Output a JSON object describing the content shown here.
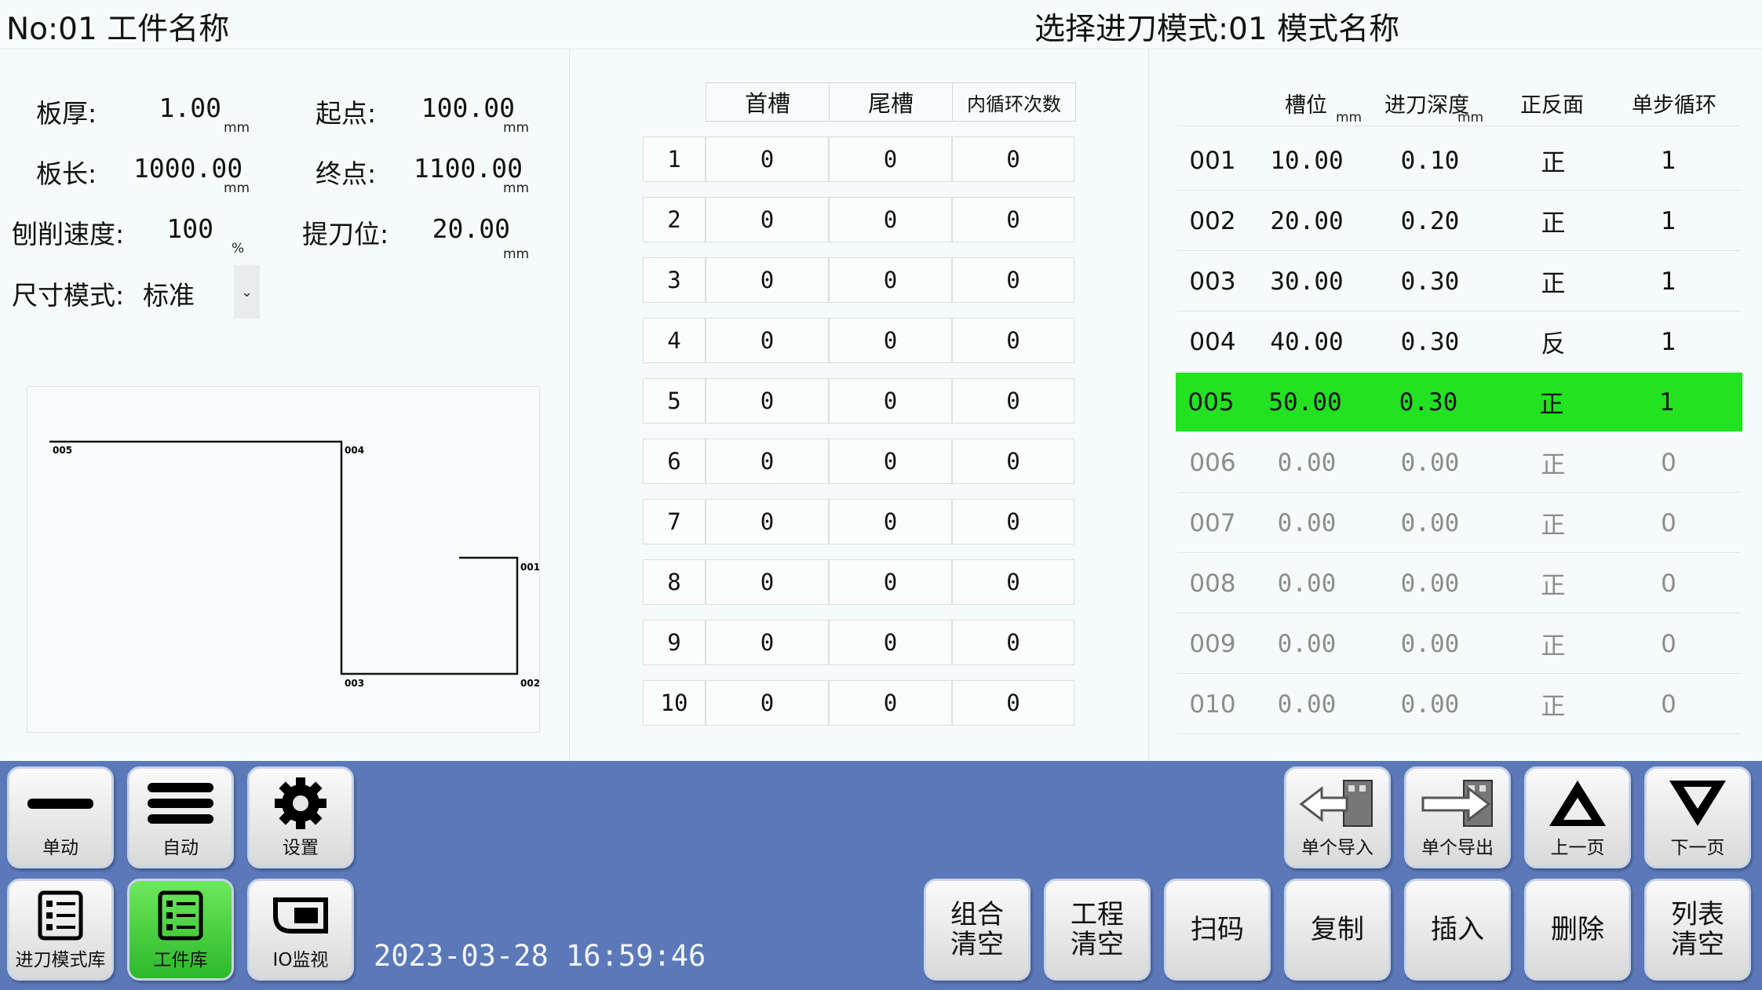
{
  "header": {
    "workpiece": "No:01 工件名称",
    "feed_mode": "选择进刀模式:01 模式名称"
  },
  "params": {
    "thickness": {
      "label": "板厚:",
      "value": "1.00",
      "unit": "mm"
    },
    "start": {
      "label": "起点:",
      "value": "100.00",
      "unit": "mm"
    },
    "length": {
      "label": "板长:",
      "value": "1000.00",
      "unit": "mm"
    },
    "end": {
      "label": "终点:",
      "value": "1100.00",
      "unit": "mm"
    },
    "speed": {
      "label": "刨削速度:",
      "value": "100",
      "unit": "%"
    },
    "lift": {
      "label": "提刀位:",
      "value": "20.00",
      "unit": "mm"
    },
    "size_mode": {
      "label": "尺寸模式:",
      "value": "标准"
    }
  },
  "preview": {
    "labels": [
      "005",
      "004",
      "001",
      "003",
      "002"
    ]
  },
  "groove_table": {
    "headers": [
      "首槽",
      "尾槽",
      "内循环次数"
    ],
    "rows": [
      [
        "1",
        "0",
        "0",
        "0"
      ],
      [
        "2",
        "0",
        "0",
        "0"
      ],
      [
        "3",
        "0",
        "0",
        "0"
      ],
      [
        "4",
        "0",
        "0",
        "0"
      ],
      [
        "5",
        "0",
        "0",
        "0"
      ],
      [
        "6",
        "0",
        "0",
        "0"
      ],
      [
        "7",
        "0",
        "0",
        "0"
      ],
      [
        "8",
        "0",
        "0",
        "0"
      ],
      [
        "9",
        "0",
        "0",
        "0"
      ],
      [
        "10",
        "0",
        "0",
        "0"
      ]
    ]
  },
  "step_table": {
    "headers": [
      "槽位",
      "进刀深度",
      "正反面",
      "单步循环"
    ],
    "unit": "mm",
    "rows": [
      [
        "001",
        "10.00",
        "0.10",
        "正",
        "1"
      ],
      [
        "002",
        "20.00",
        "0.20",
        "正",
        "1"
      ],
      [
        "003",
        "30.00",
        "0.30",
        "正",
        "1"
      ],
      [
        "004",
        "40.00",
        "0.30",
        "反",
        "1"
      ],
      [
        "005",
        "50.00",
        "0.30",
        "正",
        "1"
      ],
      [
        "006",
        "0.00",
        "0.00",
        "正",
        "0"
      ],
      [
        "007",
        "0.00",
        "0.00",
        "正",
        "0"
      ],
      [
        "008",
        "0.00",
        "0.00",
        "正",
        "0"
      ],
      [
        "009",
        "0.00",
        "0.00",
        "正",
        "0"
      ],
      [
        "010",
        "0.00",
        "0.00",
        "正",
        "0"
      ]
    ],
    "selected_row": "005"
  },
  "buttons": {
    "jog": "单动",
    "auto": "自动",
    "settings": "设置",
    "feed_library": "进刀模式库",
    "workpiece_library": "工件库",
    "io_monitor": "IO监视",
    "import_single": "单个导入",
    "export_single": "单个导出",
    "prev_page": "上一页",
    "next_page": "下一页",
    "clear_combo": "组合\n清空",
    "clear_project": "工程\n清空",
    "scan": "扫码",
    "copy": "复制",
    "insert": "插入",
    "delete": "删除",
    "clear_list": "列表\n清空"
  },
  "datetime": "2023-03-28 16:59:46",
  "colors": {
    "highlight": "#22e222",
    "bottom_bar": "#5b79b9",
    "active_button": "#3ccf36"
  }
}
